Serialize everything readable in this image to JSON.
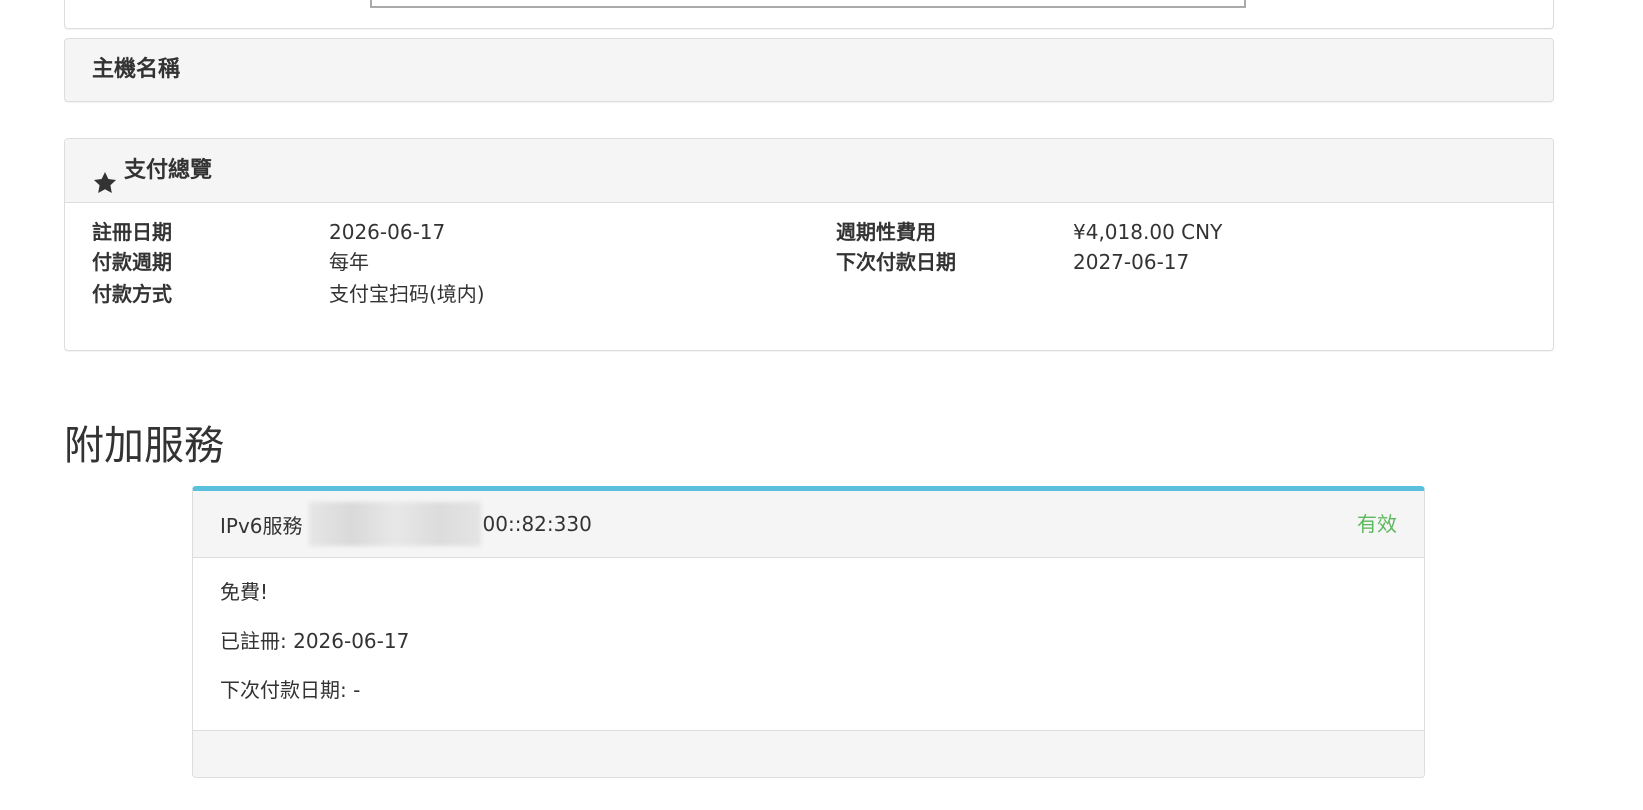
{
  "hostname_panel": {
    "title": "主機名稱"
  },
  "billing_overview": {
    "title": "支付總覽",
    "icon": "star-icon",
    "left": [
      {
        "label": "註冊日期",
        "value": "2026-06-17"
      },
      {
        "label": "付款週期",
        "value": "每年"
      },
      {
        "label": "付款方式",
        "value": "支付宝扫码(境内)"
      }
    ],
    "right": [
      {
        "label": "週期性費用",
        "value": "¥4,018.00 CNY"
      },
      {
        "label": "下次付款日期",
        "value": "2027-06-17"
      }
    ]
  },
  "addons": {
    "title": "附加服務",
    "items": [
      {
        "name": "IPv6服務",
        "address_suffix": "00::82:330",
        "status": "有效",
        "status_color": "#5cb85c",
        "accent_color": "#5bc0de",
        "lines": [
          "免費!",
          "已註冊: 2026-06-17",
          "下次付款日期: -"
        ]
      }
    ]
  }
}
